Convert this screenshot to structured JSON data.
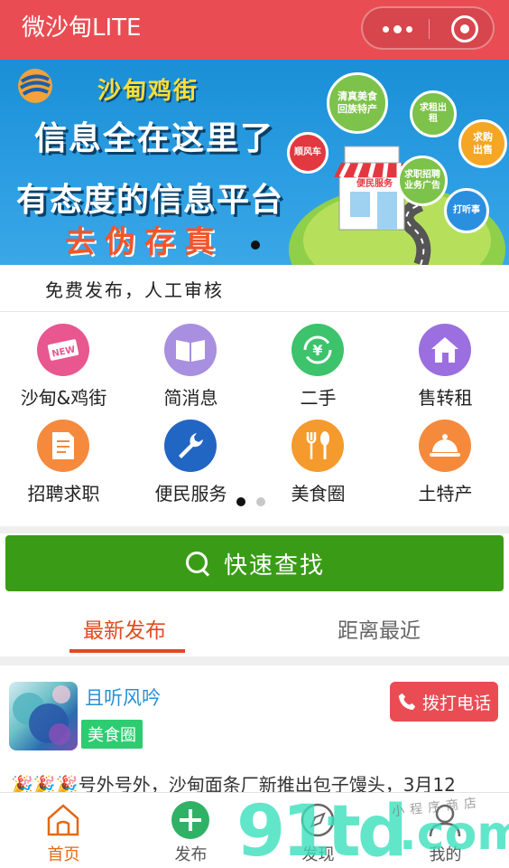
{
  "header": {
    "title": "微沙甸LITE",
    "bg_color": "#e94d53"
  },
  "banner": {
    "brand": "沙甸鸡街",
    "line1": "信息全在这里了",
    "line2": "有态度的信息平台",
    "line3": "去伪存真",
    "bubbles": [
      "清真美食回族特产",
      "求租出租",
      "顺风车",
      "求购出售",
      "求职招聘业务广告",
      "打听事",
      "便民服务"
    ]
  },
  "notice": {
    "text": "免费发布，人工审核"
  },
  "categories": [
    {
      "label": "沙甸&鸡街",
      "icon": "new-badge-icon",
      "color": "#e8578f"
    },
    {
      "label": "简消息",
      "icon": "open-book-icon",
      "color": "#a88fe0"
    },
    {
      "label": "二手",
      "icon": "yuan-exchange-icon",
      "color": "#3cc36b"
    },
    {
      "label": "售转租",
      "icon": "house-icon",
      "color": "#9b6fe0"
    },
    {
      "label": "招聘求职",
      "icon": "document-icon",
      "color": "#f58a3d"
    },
    {
      "label": "便民服务",
      "icon": "wrench-icon",
      "color": "#2266c4"
    },
    {
      "label": "美食圈",
      "icon": "fork-spoon-icon",
      "color": "#f59a2c"
    },
    {
      "label": "土特产",
      "icon": "cloche-icon",
      "color": "#f58a3d"
    }
  ],
  "pager": {
    "pages": 2,
    "current": 1
  },
  "search": {
    "label": "快速查找",
    "color": "#3a9c16"
  },
  "tabs": [
    {
      "label": "最新发布",
      "active": true
    },
    {
      "label": "距离最近",
      "active": false
    }
  ],
  "post": {
    "author": "且听风吟",
    "tag": "美食圈",
    "call_label": "拨打电话",
    "snippet": "🎉🎉🎉号外号外，沙甸面条厂新推出包子馒头，3月12"
  },
  "bottom_nav": [
    {
      "label": "首页",
      "icon": "home-icon",
      "active": true
    },
    {
      "label": "发布",
      "icon": "plus-circle-icon",
      "active": false
    },
    {
      "label": "发现",
      "icon": "compass-icon",
      "active": false
    },
    {
      "label": "我的",
      "icon": "user-icon",
      "active": false
    }
  ],
  "watermark": {
    "text": "91td",
    "suffix": ".com",
    "caption": "小程序商店"
  }
}
